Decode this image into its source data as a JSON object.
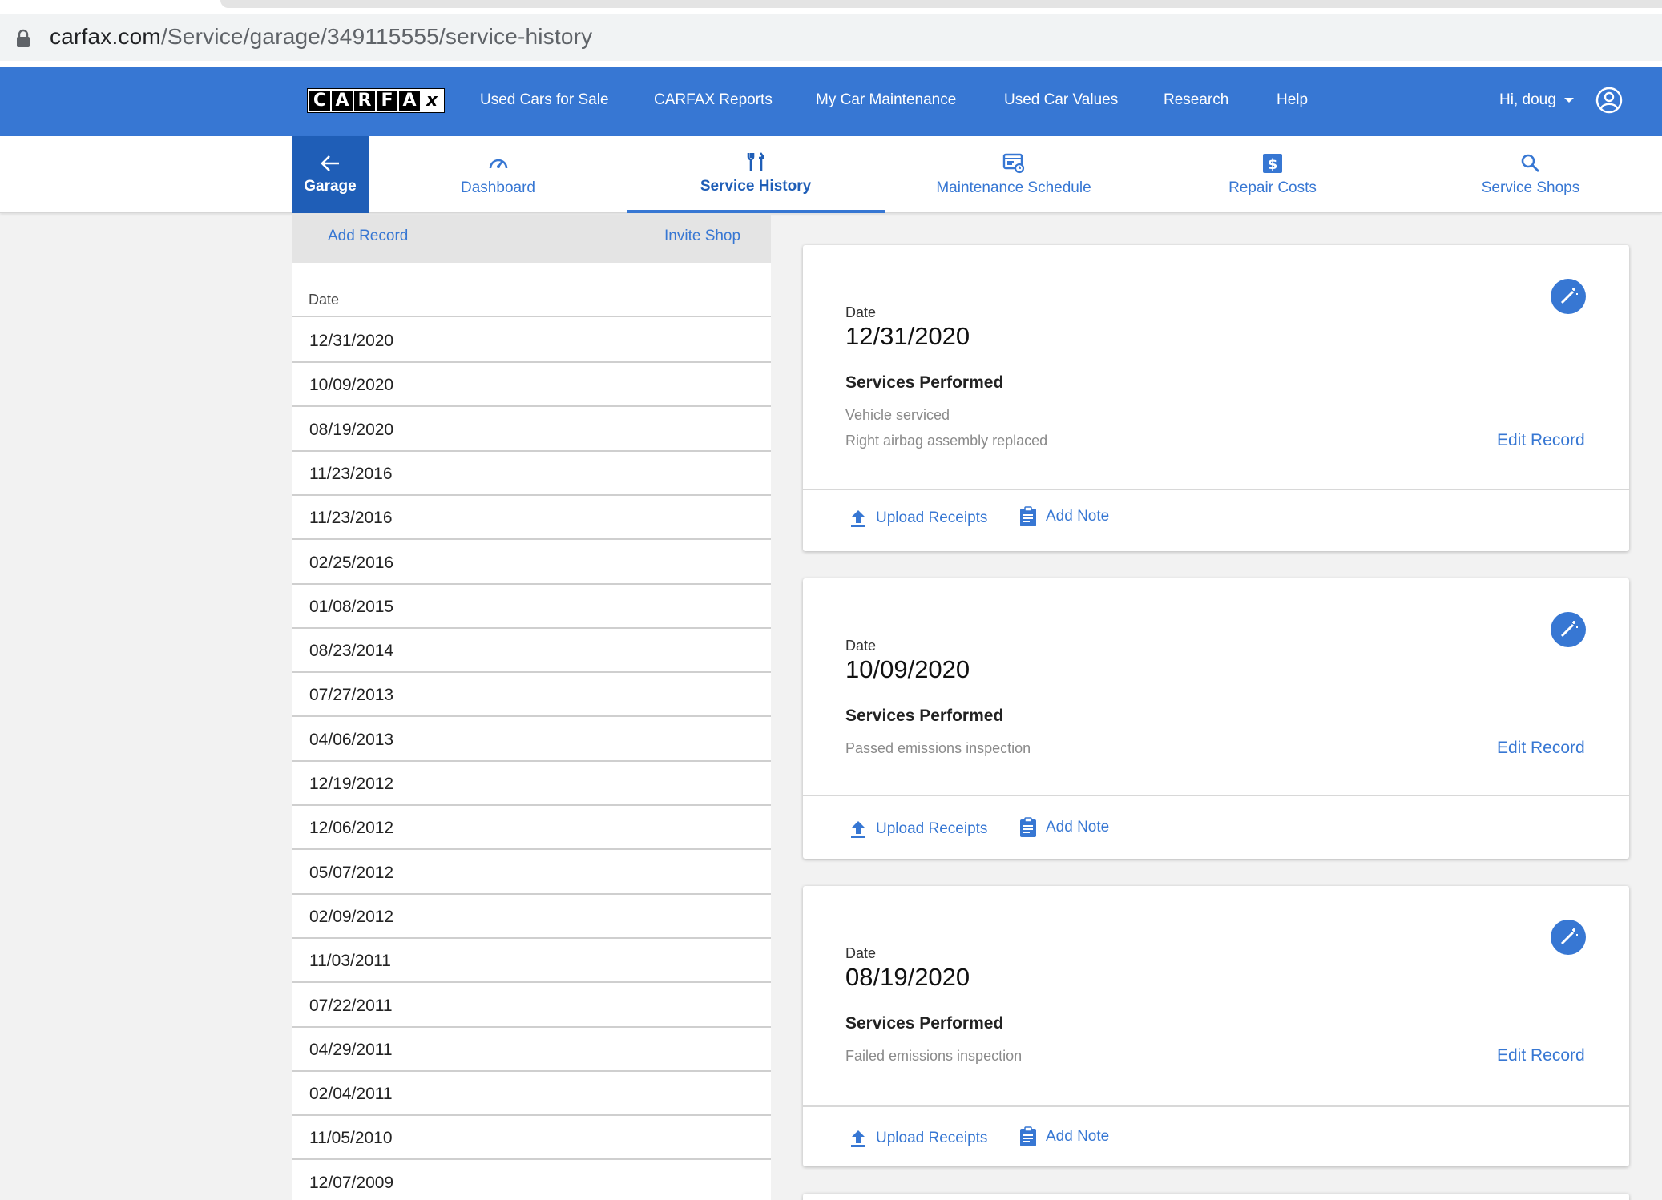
{
  "browser": {
    "url_host": "carfax.com",
    "url_path": "/Service/garage/349115555/service-history"
  },
  "topnav": {
    "logo_letters": [
      "C",
      "A",
      "R",
      "F",
      "A",
      "x"
    ],
    "links": [
      "Used Cars for Sale",
      "CARFAX Reports",
      "My Car Maintenance",
      "Used Car Values",
      "Research",
      "Help"
    ],
    "user_greeting": "Hi, doug"
  },
  "subnav": {
    "garage_label": "Garage",
    "tabs": [
      {
        "label": "Dashboard",
        "icon": "speedometer-icon"
      },
      {
        "label": "Service History",
        "icon": "tools-icon",
        "active": true
      },
      {
        "label": "Maintenance Schedule",
        "icon": "schedule-icon"
      },
      {
        "label": "Repair Costs",
        "icon": "dollar-icon"
      },
      {
        "label": "Service Shops",
        "icon": "search-icon"
      }
    ]
  },
  "left": {
    "add_record": "Add Record",
    "invite_shop": "Invite Shop",
    "header": "Date",
    "dates": [
      "12/31/2020",
      "10/09/2020",
      "08/19/2020",
      "11/23/2016",
      "11/23/2016",
      "02/25/2016",
      "01/08/2015",
      "08/23/2014",
      "07/27/2013",
      "04/06/2013",
      "12/19/2012",
      "12/06/2012",
      "05/07/2012",
      "02/09/2012",
      "11/03/2011",
      "07/22/2011",
      "04/29/2011",
      "02/04/2011",
      "11/05/2010",
      "12/07/2009"
    ]
  },
  "records": [
    {
      "date_label": "Date",
      "date": "12/31/2020",
      "services_label": "Services Performed",
      "services": [
        "Vehicle serviced",
        "Right airbag assembly replaced"
      ],
      "edit": "Edit Record",
      "upload": "Upload Receipts",
      "note": "Add Note"
    },
    {
      "date_label": "Date",
      "date": "10/09/2020",
      "services_label": "Services Performed",
      "services": [
        "Passed emissions inspection"
      ],
      "edit": "Edit Record",
      "upload": "Upload Receipts",
      "note": "Add Note"
    },
    {
      "date_label": "Date",
      "date": "08/19/2020",
      "services_label": "Services Performed",
      "services": [
        "Failed emissions inspection"
      ],
      "edit": "Edit Record",
      "upload": "Upload Receipts",
      "note": "Add Note"
    }
  ],
  "colors": {
    "brand_blue": "#3777d3",
    "garage_blue": "#1f5eb7"
  }
}
